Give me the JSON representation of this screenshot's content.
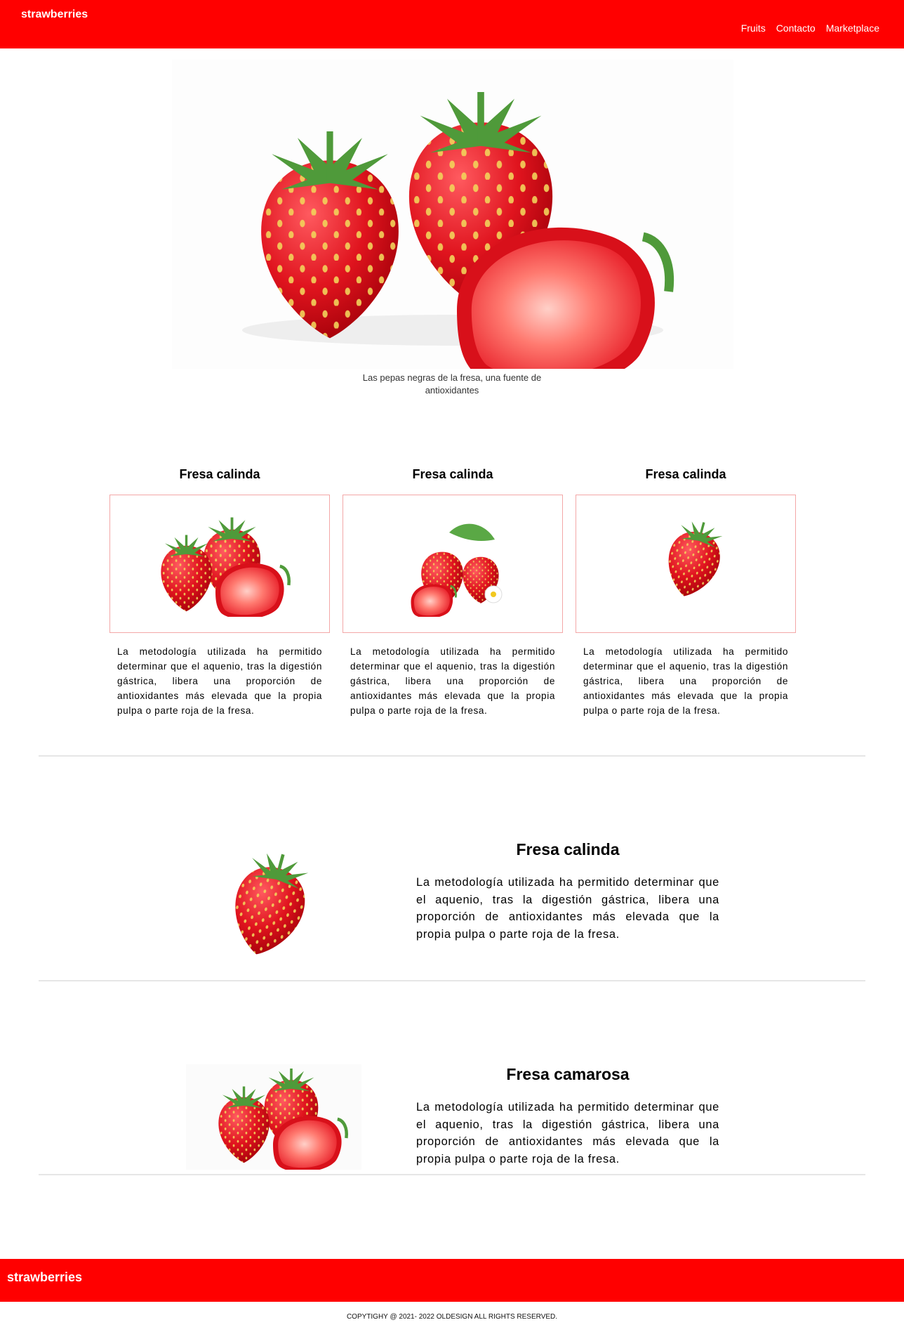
{
  "header": {
    "logo": "strawberries",
    "nav": [
      "Fruits",
      "Contacto",
      "Marketplace"
    ]
  },
  "hero": {
    "caption": "Las pepas negras de la fresa, una fuente de antioxidantes"
  },
  "cards": [
    {
      "title": "Fresa calinda",
      "text": "La metodología utilizada ha permitido determinar que el aquenio, tras la digestión gástrica, libera una proporción de antioxidantes más elevada que la propia pulpa o parte roja de la fresa."
    },
    {
      "title": "Fresa calinda",
      "text": "La metodología utilizada ha permitido determinar que el aquenio, tras la digestión gástrica, libera una proporción de antioxidantes más elevada que la propia pulpa o parte roja de la fresa."
    },
    {
      "title": "Fresa calinda",
      "text": "La metodología utilizada ha permitido determinar que el aquenio, tras la digestión gástrica, libera una proporción de antioxidantes más elevada que la propia pulpa o parte roja de la fresa."
    }
  ],
  "features": [
    {
      "title": "Fresa calinda",
      "text": "La metodología utilizada ha permitido determinar que el aquenio, tras la digestión gástrica, libera una proporción de antioxidantes más elevada que la propia pulpa o parte roja de la fresa."
    },
    {
      "title": "Fresa camarosa",
      "text": "La metodología utilizada ha permitido determinar que el aquenio, tras la digestión gástrica, libera una proporción de antioxidantes más elevada que la propia pulpa o parte roja de la fresa."
    }
  ],
  "footer": {
    "logo": "strawberries",
    "copyright": "COPYTIGHY @ 2021- 2022 OLDESIGN ALL RIGHTS RESERVED."
  },
  "colors": {
    "brand": "#ff0000",
    "card_border": "#f3a7a7",
    "divider": "#e6e6e6"
  }
}
